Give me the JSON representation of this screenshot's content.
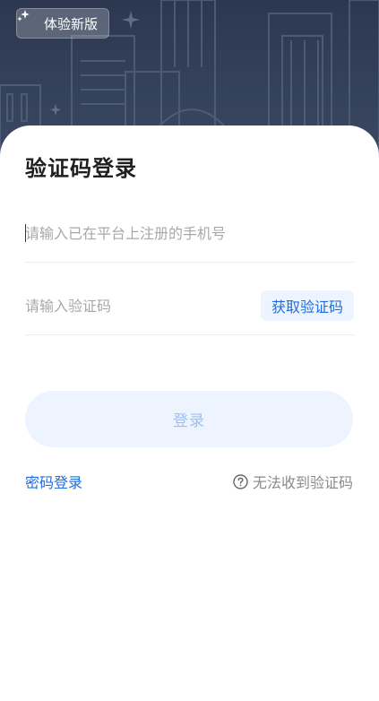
{
  "header": {
    "badge_label": "体验新版",
    "badge_icon": "sparkle-icon"
  },
  "login": {
    "title": "验证码登录",
    "phone_placeholder": "请输入已在平台上注册的手机号",
    "phone_value": "",
    "code_placeholder": "请输入验证码",
    "code_value": "",
    "get_code_label": "获取验证码",
    "submit_label": "登录",
    "password_login_label": "密码登录",
    "no_code_label": "无法收到验证码",
    "no_code_icon": "question-circle-icon"
  },
  "colors": {
    "accent": "#1e6de0",
    "header_bg": "#2c3850",
    "button_bg": "#eef4fe",
    "button_text": "#9fc0f4"
  }
}
